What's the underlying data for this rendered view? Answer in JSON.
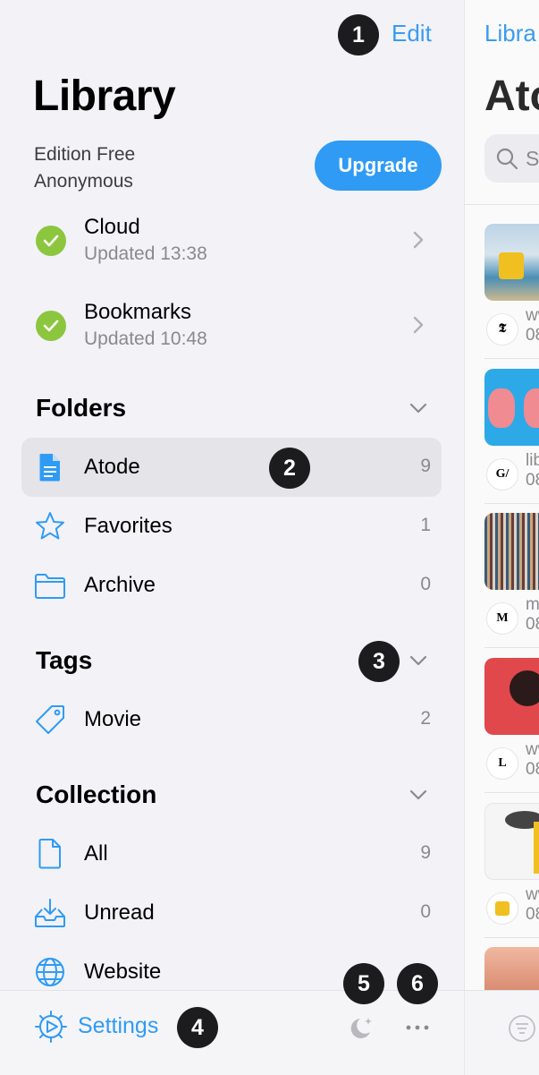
{
  "sidebar": {
    "edit_label": "Edit",
    "title": "Library",
    "edition_line1": "Edition Free",
    "edition_line2": "Anonymous",
    "upgrade_label": "Upgrade",
    "sync": [
      {
        "title": "Cloud",
        "subtitle": "Updated 13:38"
      },
      {
        "title": "Bookmarks",
        "subtitle": "Updated 10:48"
      }
    ],
    "folders": {
      "heading": "Folders",
      "items": [
        {
          "label": "Atode",
          "count": "9",
          "icon": "document-icon",
          "selected": true
        },
        {
          "label": "Favorites",
          "count": "1",
          "icon": "star-icon"
        },
        {
          "label": "Archive",
          "count": "0",
          "icon": "folder-icon"
        }
      ]
    },
    "tags": {
      "heading": "Tags",
      "items": [
        {
          "label": "Movie",
          "count": "2",
          "icon": "tag-icon"
        }
      ]
    },
    "collection": {
      "heading": "Collection",
      "items": [
        {
          "label": "All",
          "count": "9",
          "icon": "page-icon"
        },
        {
          "label": "Unread",
          "count": "0",
          "icon": "inbox-icon"
        },
        {
          "label": "Website",
          "count": "",
          "icon": "globe-icon"
        }
      ]
    },
    "toolbar": {
      "settings_label": "Settings"
    }
  },
  "annotations": [
    "1",
    "2",
    "3",
    "4",
    "5",
    "6"
  ],
  "right_panel": {
    "back_label": "Libra",
    "title": "Atode",
    "search_placeholder": "S",
    "cards": [
      {
        "favicon": "𝕿",
        "source_line1": "ww",
        "source_line2": "08"
      },
      {
        "favicon": "G/",
        "source_line1": "lib",
        "source_line2": "08"
      },
      {
        "favicon": "M",
        "source_line1": "m",
        "source_line2": "08"
      },
      {
        "favicon": "L",
        "source_line1": "ww",
        "source_line2": "08"
      },
      {
        "favicon": "",
        "source_line1": "ww",
        "source_line2": "08"
      }
    ]
  },
  "colors": {
    "accent": "#2f9bf5",
    "check": "#8cc63f",
    "sidebar_bg": "#f2f2f7",
    "selected_bg": "#e4e4e9",
    "badge": "#1c1c1e"
  }
}
